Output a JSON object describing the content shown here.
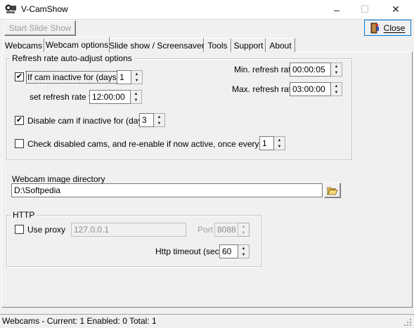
{
  "window": {
    "title": "V-CamShow",
    "minimize_glyph": "–",
    "maximize_glyph": "☐",
    "close_glyph": "✕"
  },
  "toolbar": {
    "start_slideshow_label": "Start Slide Show",
    "close_label": "Close"
  },
  "tabs": [
    {
      "label": "Webcams"
    },
    {
      "label": "Webcam options"
    },
    {
      "label": "Slide show / Screensaver"
    },
    {
      "label": "Tools"
    },
    {
      "label": "Support"
    },
    {
      "label": "About"
    }
  ],
  "refresh_group": {
    "legend": "Refresh rate auto-adjust options",
    "if_inactive_label": "If cam inactive for (days)",
    "if_inactive_checked": true,
    "if_inactive_days": "1",
    "set_refresh_label": "set refresh rate to",
    "set_refresh_value": "12:00:00",
    "min_refresh_label": "Min. refresh rate",
    "min_refresh_value": "00:00:05",
    "max_refresh_label": "Max. refresh rate",
    "max_refresh_value": "03:00:00",
    "disable_cam_label": "Disable cam if inactive for (days)",
    "disable_cam_checked": true,
    "disable_cam_days": "3",
    "check_disabled_label": "Check disabled cams, and re-enable if now active, once every (days)",
    "check_disabled_checked": false,
    "check_disabled_days": "1"
  },
  "directory": {
    "label": "Webcam image directory",
    "value": "D:\\Softpedia"
  },
  "http": {
    "legend": "HTTP",
    "use_proxy_label": "Use proxy",
    "use_proxy_checked": false,
    "proxy_address": "127.0.0.1",
    "port_label": "Port",
    "port_value": "8088",
    "timeout_label": "Http timeout (secs)",
    "timeout_value": "60"
  },
  "status": {
    "text": "Webcams - Current: 1  Enabled: 0  Total: 1"
  },
  "icons": {
    "check_glyph": "✔",
    "spin_up": "▲",
    "spin_down": "▼"
  }
}
